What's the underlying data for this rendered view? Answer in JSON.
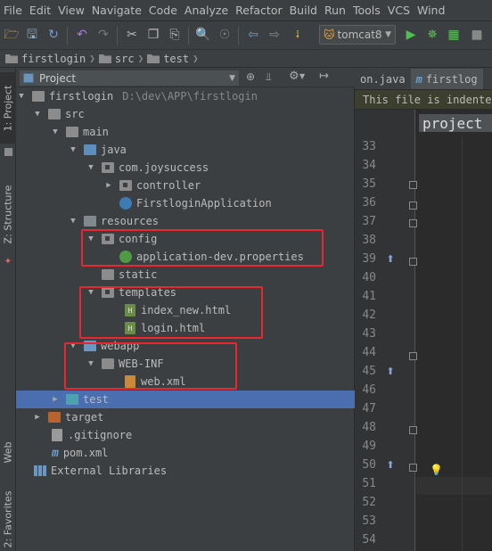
{
  "menu": [
    "File",
    "Edit",
    "View",
    "Navigate",
    "Code",
    "Analyze",
    "Refactor",
    "Build",
    "Run",
    "Tools",
    "VCS",
    "Wind"
  ],
  "toolbar": {
    "run_config": "tomcat8"
  },
  "breadcrumb": [
    "firstlogin",
    "src",
    "test"
  ],
  "left_stripe": {
    "project_tab": "1: Project",
    "structure_tab": "Z: Structure",
    "web_tab": "Web",
    "favorites_tab": "2: Favorites"
  },
  "panel": {
    "title": "Project"
  },
  "tree": [
    {
      "label": "firstlogin",
      "hint": "D:\\dev\\APP\\firstlogin"
    },
    {
      "label": "src"
    },
    {
      "label": "main"
    },
    {
      "label": "java"
    },
    {
      "label": "com.joysuccess"
    },
    {
      "label": "controller"
    },
    {
      "label": "FirstloginApplication"
    },
    {
      "label": "resources"
    },
    {
      "label": "config"
    },
    {
      "label": "application-dev.properties"
    },
    {
      "label": "static"
    },
    {
      "label": "templates"
    },
    {
      "label": "index_new.html"
    },
    {
      "label": "login.html"
    },
    {
      "label": "webapp"
    },
    {
      "label": "WEB-INF"
    },
    {
      "label": "web.xml"
    },
    {
      "label": "test"
    },
    {
      "label": "target"
    },
    {
      "label": ".gitignore"
    },
    {
      "label": "pom.xml"
    },
    {
      "label": "External Libraries"
    }
  ],
  "editor": {
    "tabs": [
      "on.java",
      "firstlog"
    ],
    "notice": "This file is indented",
    "header_text": "project",
    "line_numbers": [
      "33",
      "34",
      "35",
      "36",
      "37",
      "38",
      "39",
      "40",
      "41",
      "42",
      "43",
      "44",
      "45",
      "46",
      "47",
      "48",
      "49",
      "50",
      "51",
      "52",
      "53",
      "54"
    ]
  },
  "colors": {
    "highlight_box": "#e8272f",
    "selection": "#4b6eaf"
  }
}
